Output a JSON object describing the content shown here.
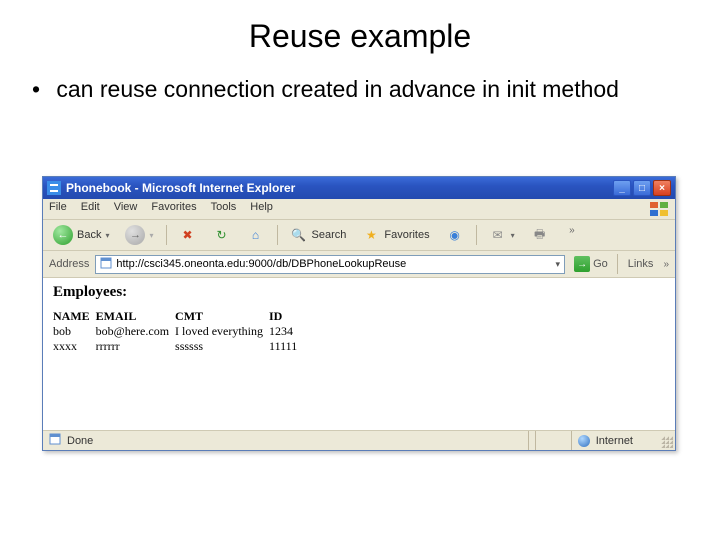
{
  "slide": {
    "title": "Reuse example",
    "bullet": "can reuse connection created in advance in init method"
  },
  "window": {
    "title": "Phonebook - Microsoft Internet Explorer"
  },
  "menu": {
    "file": "File",
    "edit": "Edit",
    "view": "View",
    "favorites": "Favorites",
    "tools": "Tools",
    "help": "Help"
  },
  "toolbar": {
    "back": "Back",
    "search": "Search",
    "favorites": "Favorites"
  },
  "address": {
    "label": "Address",
    "url": "http://csci345.oneonta.edu:9000/db/DBPhoneLookupReuse",
    "go": "Go",
    "links": "Links"
  },
  "page": {
    "heading": "Employees:",
    "headers": {
      "name": "NAME",
      "email": "EMAIL",
      "cmt": "CMT",
      "id": "ID"
    },
    "rows": [
      {
        "name": "bob",
        "email": "bob@here.com",
        "cmt": "I loved everything",
        "id": "1234"
      },
      {
        "name": "xxxx",
        "email": "rrrrrr",
        "cmt": "ssssss",
        "id": "11111"
      }
    ]
  },
  "status": {
    "done": "Done",
    "zone": "Internet"
  }
}
